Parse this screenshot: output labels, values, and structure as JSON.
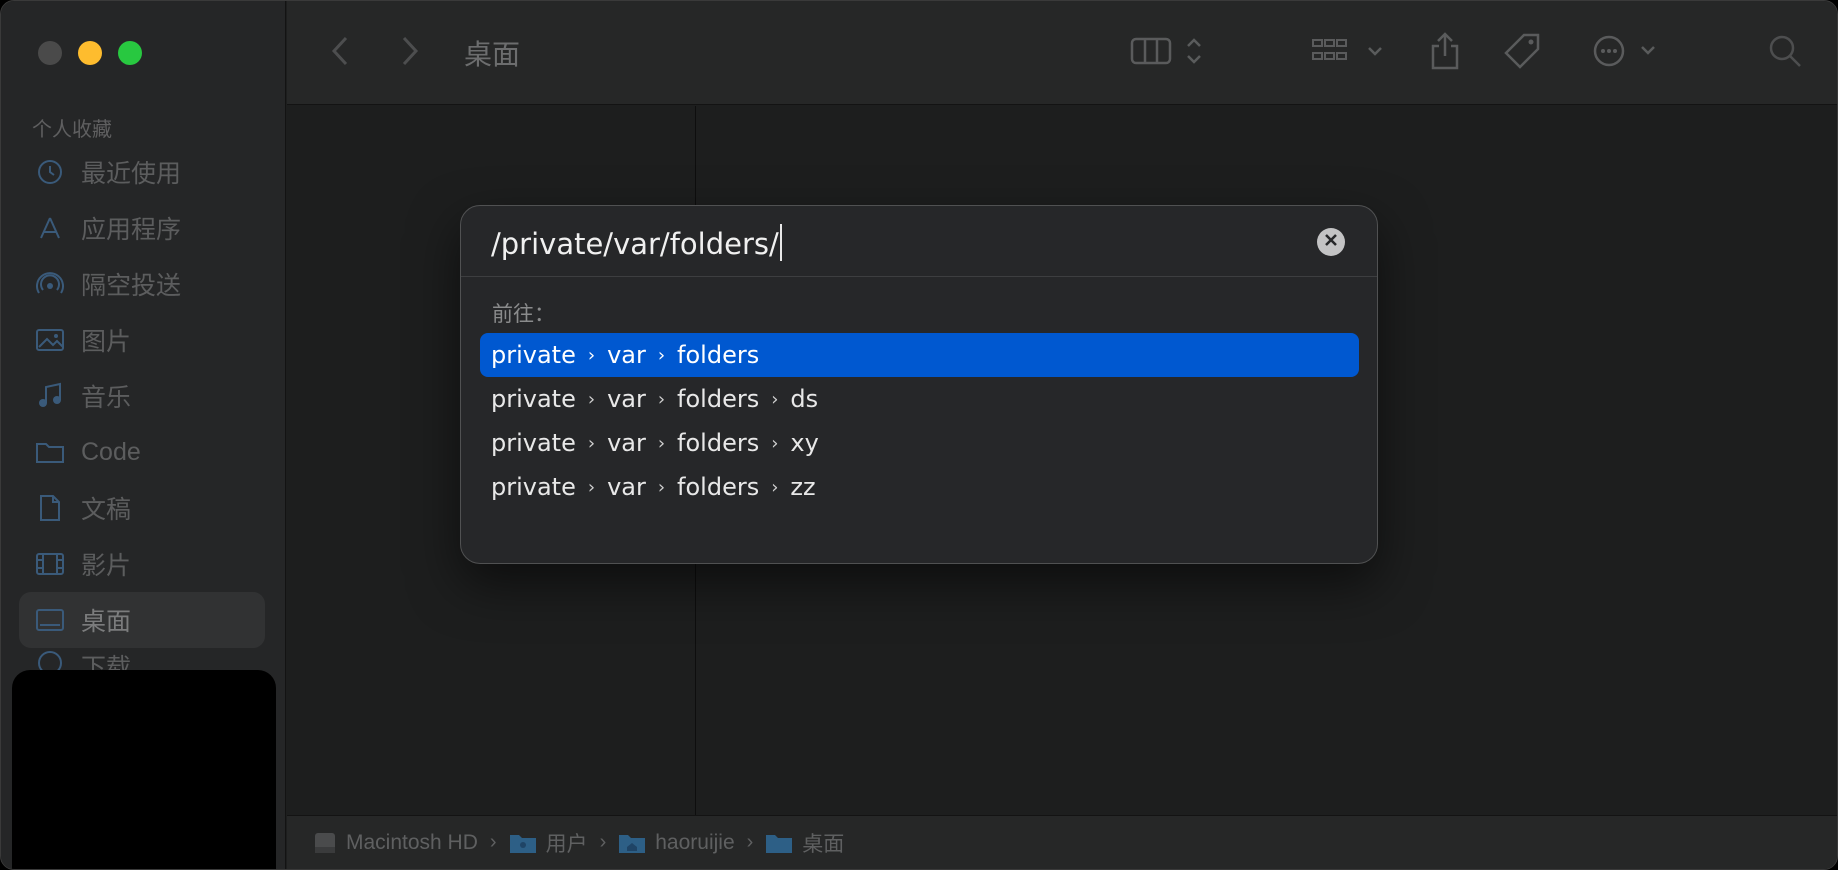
{
  "window": {
    "title": "桌面"
  },
  "sidebar": {
    "section_title": "个人收藏",
    "items": [
      {
        "label": "最近使用",
        "icon": "clock-icon"
      },
      {
        "label": "应用程序",
        "icon": "apps-icon"
      },
      {
        "label": "隔空投送",
        "icon": "airdrop-icon"
      },
      {
        "label": "图片",
        "icon": "photo-icon"
      },
      {
        "label": "音乐",
        "icon": "music-icon"
      },
      {
        "label": "Code",
        "icon": "folder-icon"
      },
      {
        "label": "文稿",
        "icon": "document-icon"
      },
      {
        "label": "影片",
        "icon": "film-icon"
      },
      {
        "label": "桌面",
        "icon": "desktop-icon",
        "active": true
      },
      {
        "label": "下载",
        "icon": "download-icon"
      }
    ]
  },
  "pathbar": {
    "crumbs": [
      {
        "label": "Macintosh HD",
        "icon": "disk-icon"
      },
      {
        "label": "用户",
        "icon": "folder-icon"
      },
      {
        "label": "haoruijie",
        "icon": "home-folder-icon"
      },
      {
        "label": "桌面",
        "icon": "folder-icon"
      }
    ]
  },
  "goto_dialog": {
    "input_value": "/private/var/folders/",
    "goto_label": "前往：",
    "suggestions": [
      {
        "segments": [
          "private",
          "var",
          "folders"
        ],
        "selected": true
      },
      {
        "segments": [
          "private",
          "var",
          "folders",
          "ds"
        ],
        "selected": false
      },
      {
        "segments": [
          "private",
          "var",
          "folders",
          "xy"
        ],
        "selected": false
      },
      {
        "segments": [
          "private",
          "var",
          "folders",
          "zz"
        ],
        "selected": false
      }
    ]
  },
  "colors": {
    "accent": "#0058d0",
    "traffic_min": "#febc2e",
    "traffic_max": "#28c840"
  }
}
